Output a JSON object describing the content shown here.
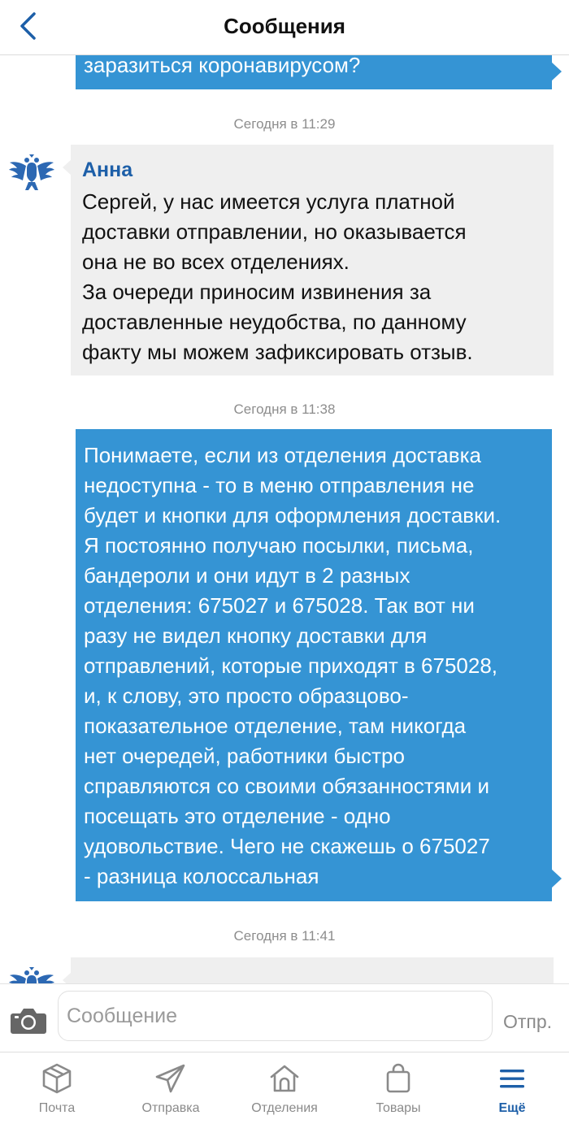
{
  "header": {
    "title": "Сообщения"
  },
  "messages": {
    "m1": {
      "text": "заразиться коронавирусом?"
    },
    "t1": "Сегодня в 11:29",
    "m2": {
      "sender": "Анна",
      "lines": [
        "Сергей, у нас имеется услуга платной",
        "доставки отправлении, но оказывается",
        "она не во всех отделениях.",
        "За очереди приносим извинения за",
        "доставленные неудобства, по данному",
        "факту мы можем зафиксировать отзыв."
      ]
    },
    "t2": "Сегодня в 11:38",
    "m3": {
      "lines": [
        "Понимаете, если из отделения доставка",
        "недоступна - то в меню отправления не",
        "будет и кнопки для оформления доставки.",
        "Я постоянно получаю посылки, письма,",
        "бандероли и они идут в 2 разных",
        "отделения: 675027 и 675028. Так вот ни",
        "разу не видел кнопку доставки для",
        "отправлений, которые приходят в 675028,",
        "и, к слову, это просто образцово-",
        "показательное отделение, там никогда",
        "нет очередей, работники быстро",
        "справляются со своими обязанностями и",
        "посещать это отделение - одно",
        "удовольствие. Чего не скажешь о 675027",
        "- разница колоссальная"
      ]
    },
    "t3": "Сегодня в 11:41",
    "m4": {
      "sender": ""
    }
  },
  "composer": {
    "placeholder": "Сообщение",
    "send_label": "Отпр."
  },
  "tabs": [
    {
      "label": "Почта",
      "icon": "package-icon"
    },
    {
      "label": "Отправка",
      "icon": "paper-plane-icon"
    },
    {
      "label": "Отделения",
      "icon": "post-office-icon"
    },
    {
      "label": "Товары",
      "icon": "shopping-bag-icon"
    },
    {
      "label": "Ещё",
      "icon": "menu-icon",
      "active": true
    }
  ],
  "colors": {
    "accent": "#1d5fa8",
    "outgoing_bubble": "#3594d4",
    "incoming_bubble": "#efefef",
    "muted_text": "#8d8d8d"
  }
}
